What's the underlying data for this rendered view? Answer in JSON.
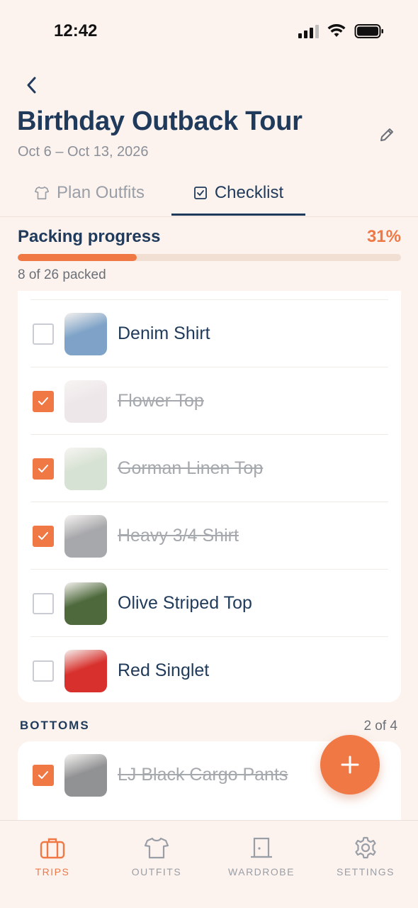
{
  "status": {
    "time": "12:42"
  },
  "header": {
    "title": "Birthday Outback Tour",
    "dates": "Oct 6 – Oct 13, 2026"
  },
  "tabs": [
    {
      "label": "Plan Outfits",
      "icon": "shirt-icon",
      "active": false
    },
    {
      "label": "Checklist",
      "icon": "checkbox-icon",
      "active": true
    }
  ],
  "progress": {
    "label": "Packing progress",
    "percent_text": "31%",
    "fraction": 0.31,
    "count_text": "8 of 26 packed"
  },
  "tops_items": [
    {
      "label": "Denim Shirt",
      "checked": false,
      "thumb_color": "#7fa3c8"
    },
    {
      "label": "Flower Top",
      "checked": true,
      "thumb_color": "#e9dfe3"
    },
    {
      "label": "Gorman Linen Top",
      "checked": true,
      "thumb_color": "#c9d8c4"
    },
    {
      "label": "Heavy 3/4 Shirt",
      "checked": true,
      "thumb_color": "#8a8b8f"
    },
    {
      "label": "Olive Striped Top",
      "checked": false,
      "thumb_color": "#4e6a3c"
    },
    {
      "label": "Red Singlet",
      "checked": false,
      "thumb_color": "#d8302c"
    }
  ],
  "bottoms": {
    "heading": "BOTTOMS",
    "count_text": "2 of 4",
    "items": [
      {
        "label": "LJ Black Cargo Pants",
        "checked": true,
        "thumb_color": "#6c6d70"
      }
    ]
  },
  "nav": [
    {
      "label": "TRIPS",
      "icon": "suitcase-icon",
      "active": true
    },
    {
      "label": "OUTFITS",
      "icon": "shirt-icon",
      "active": false
    },
    {
      "label": "WARDROBE",
      "icon": "door-icon",
      "active": false
    },
    {
      "label": "SETTINGS",
      "icon": "gear-icon",
      "active": false
    }
  ],
  "colors": {
    "accent": "#f07845",
    "navy": "#1f3a5a",
    "background": "#fcf3ee"
  }
}
